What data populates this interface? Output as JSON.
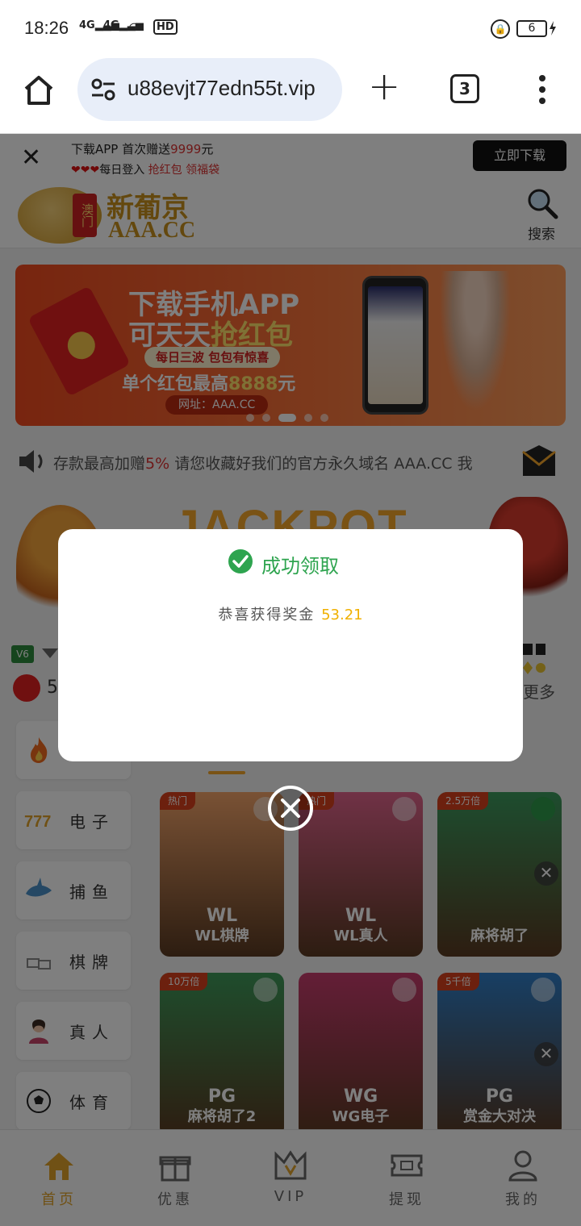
{
  "status_bar": {
    "time": "18:26",
    "signal1": "4G",
    "signal2": "4G",
    "hd": "HD",
    "battery": "6"
  },
  "browser": {
    "url": "u88evjt77edn55t.vip",
    "tab_count": "3"
  },
  "promo_bar": {
    "line1_prefix": "下载APP 首次赠送",
    "line1_amount": "9999",
    "line1_suffix": "元",
    "line2_hearts": "❤❤❤",
    "line2_prefix": "每日登入 ",
    "line2_highlight": "抢红包 领福袋",
    "download_button": "立即下载"
  },
  "header": {
    "logo_badge_text": "澳门",
    "logo_name": "新葡京",
    "logo_domain": "AAA.CC",
    "search_label": "搜索"
  },
  "banner": {
    "line1": "下载手机APP",
    "line2_prefix": "可天天",
    "line2_highlight": "抢红包",
    "pill": "每日三波 包包有惊喜",
    "line4_prefix": "单个红包最高",
    "line4_amount": "8888",
    "line4_suffix": "元",
    "site": "网址：AAA.CC"
  },
  "marquee": {
    "text_prefix": "存款最高加赠",
    "text_highlight": "5%",
    "text_suffix": " 请您收藏好我们的官方永久域名 AAA.CC 我"
  },
  "jackpot": {
    "text": "JACKPOT"
  },
  "flag_row": {
    "vip_badge": "V6",
    "number": "5",
    "more": "更多"
  },
  "sidebar": [
    {
      "label": "",
      "icon": "fire-icon"
    },
    {
      "label": "电子",
      "icon": "slot-777-icon"
    },
    {
      "label": "捕鱼",
      "icon": "shark-icon"
    },
    {
      "label": "棋牌",
      "icon": "cards-icon"
    },
    {
      "label": "真人",
      "icon": "dealer-icon"
    },
    {
      "label": "体育",
      "icon": "soccer-icon"
    }
  ],
  "games": [
    {
      "tag": "热门",
      "brand": "WL",
      "title": "WL棋牌",
      "color": "#f3a46a"
    },
    {
      "tag": "热门",
      "brand": "WL",
      "title": "WL真人",
      "color": "#e1648c"
    },
    {
      "tag": "2.5万倍",
      "brand": "",
      "title": "麻将胡了",
      "color": "#3c9a5e"
    },
    {
      "tag": "10万倍",
      "brand": "PG",
      "title": "麻将胡了2",
      "color": "#3e9a5a"
    },
    {
      "tag": "",
      "brand": "WG",
      "title": "WG电子",
      "color": "#c83c6e"
    },
    {
      "tag": "5千倍",
      "brand": "PG",
      "title": "赏金大对决",
      "color": "#2f7ec8"
    }
  ],
  "bottom_nav": [
    {
      "label": "首页",
      "active": true
    },
    {
      "label": "优惠",
      "active": false
    },
    {
      "label": "VIP",
      "active": false
    },
    {
      "label": "提现",
      "active": false
    },
    {
      "label": "我的",
      "active": false
    }
  ],
  "dialog": {
    "title": "成功领取",
    "message": "恭喜获得奖金",
    "amount": "53.21"
  },
  "colors": {
    "accent": "#e0a22a",
    "success": "#2ea44f",
    "amount": "#f0b000"
  }
}
